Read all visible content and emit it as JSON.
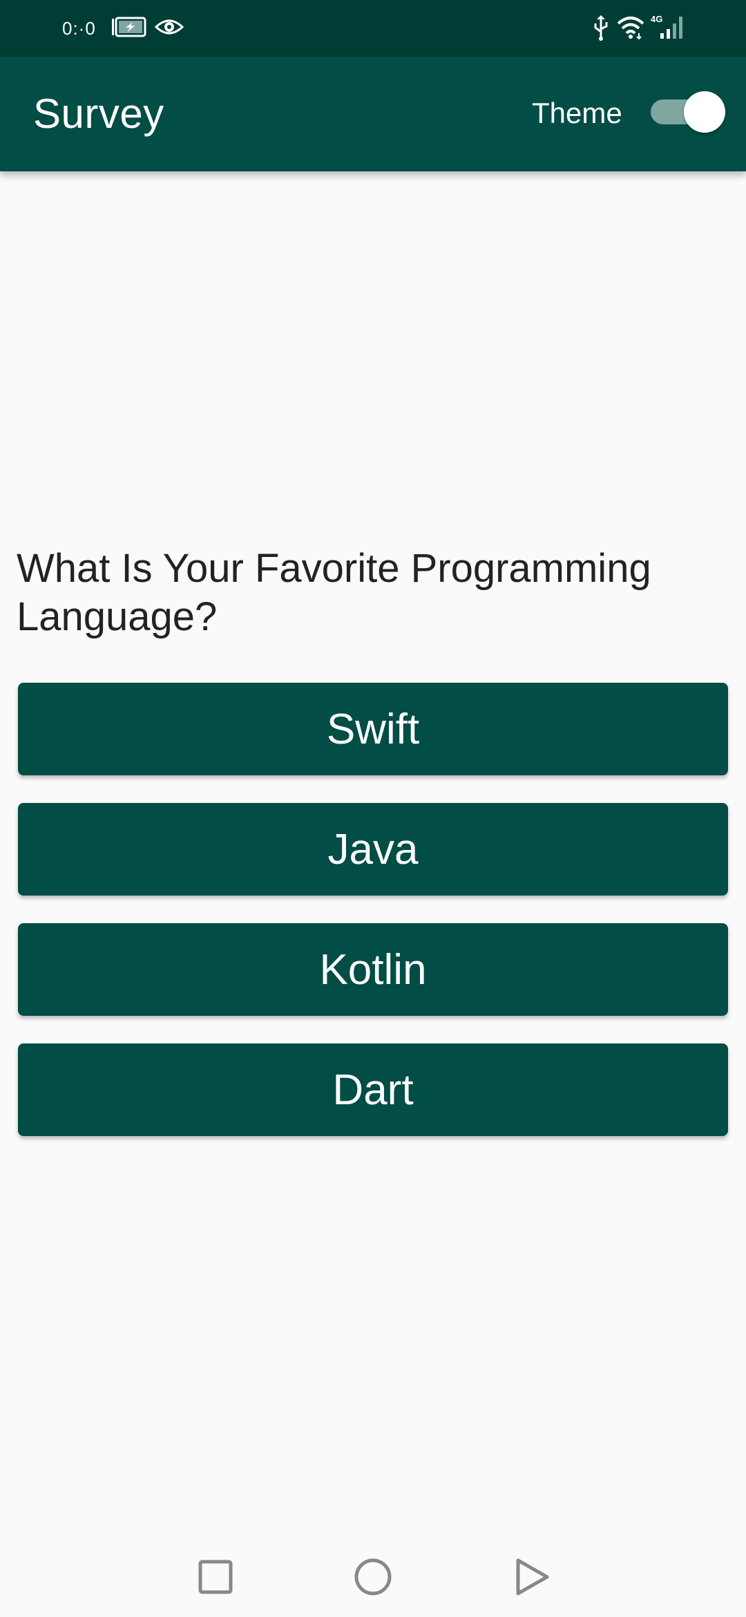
{
  "status_bar": {
    "time": "0:·0",
    "icons": [
      "battery-charging-icon",
      "eye-icon",
      "usb-icon",
      "wifi-icon",
      "signal-4g-icon"
    ],
    "signal_label": "4G",
    "background_color": "#003d35"
  },
  "app_bar": {
    "title": "Survey",
    "theme_label": "Theme",
    "theme_switch_on": true,
    "background_color": "#024d45"
  },
  "question": {
    "text": "What Is Your Favorite Programming Language?"
  },
  "answers": [
    {
      "label": "Swift"
    },
    {
      "label": "Java"
    },
    {
      "label": "Kotlin"
    },
    {
      "label": "Dart"
    }
  ],
  "nav_bar": {
    "icons": [
      "recent-apps-icon",
      "home-icon",
      "back-icon"
    ]
  },
  "colors": {
    "primary": "#024d45",
    "background": "#fafafa",
    "text": "#222222"
  }
}
